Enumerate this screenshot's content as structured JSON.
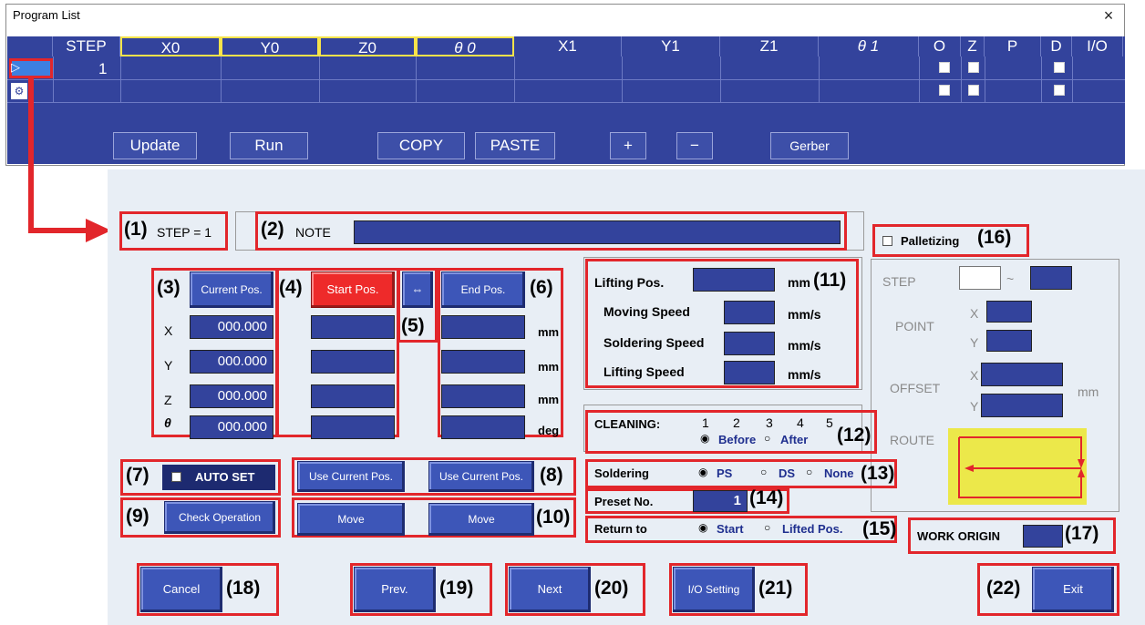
{
  "program_list": {
    "title": "Program List",
    "close": "×",
    "columns": [
      "STEP",
      "X0",
      "Y0",
      "Z0",
      "θ 0",
      "X1",
      "Y1",
      "Z1",
      "θ 1",
      "O",
      "Z",
      "P",
      "D",
      "I/O"
    ],
    "row1_step": "1",
    "row_marker_1": "▷",
    "row_marker_2": "⚙",
    "buttons": {
      "update": "Update",
      "run": "Run",
      "copy": "COPY",
      "paste": "PASTE",
      "plus": "+",
      "minus": "−",
      "gerber": "Gerber"
    }
  },
  "dialog": {
    "step": "STEP = 1",
    "note_label": "NOTE",
    "buttons": {
      "current_pos": "Current Pos.",
      "start_pos": "Start Pos.",
      "swap": "⇔",
      "end_pos": "End Pos.",
      "use_current_1": "Use Current Pos.",
      "use_current_2": "Use Current Pos.",
      "check_operation": "Check Operation",
      "move_1": "Move",
      "move_2": "Move",
      "cancel": "Cancel",
      "prev": "Prev.",
      "next": "Next",
      "io_setting": "I/O Setting",
      "exit": "Exit"
    },
    "axes": [
      "X",
      "Y",
      "Z",
      "θ"
    ],
    "current_values": [
      "000.000",
      "000.000",
      "000.000",
      "000.000"
    ],
    "units": [
      "mm",
      "mm",
      "mm",
      "deg"
    ],
    "auto_set": "AUTO SET",
    "lifting": {
      "lifting_pos": "Lifting Pos.",
      "lifting_pos_unit": "mm",
      "moving_speed": "Moving Speed",
      "moving_unit": "mm/s",
      "soldering_speed": "Soldering Speed",
      "soldering_unit": "mm/s",
      "lifting_speed": "Lifting Speed",
      "lifting_unit": "mm/s"
    },
    "cleaning": {
      "label": "CLEANING:",
      "nums": [
        "1",
        "2",
        "3",
        "4",
        "5"
      ],
      "before": "Before",
      "after": "After",
      "selected": "Before"
    },
    "soldering": {
      "label": "Soldering",
      "opt_ps": "PS",
      "opt_ds": "DS",
      "opt_none": "None",
      "selected": "PS"
    },
    "preset": {
      "label": "Preset No.",
      "value": "1"
    },
    "return_to": {
      "label": "Return to",
      "opt_start": "Start",
      "opt_lifted": "Lifted Pos.",
      "selected": "Start"
    },
    "palletizing": {
      "label": "Palletizing",
      "step": "STEP",
      "tilde": "~",
      "point": "POINT",
      "x": "X",
      "y": "Y",
      "offset": "OFFSET",
      "offset_x": "X",
      "offset_y": "Y",
      "mm": "mm",
      "route": "ROUTE"
    },
    "work_origin": "WORK ORIGIN"
  },
  "callouts": [
    "(1)",
    "(2)",
    "(3)",
    "(4)",
    "(5)",
    "(6)",
    "(7)",
    "(8)",
    "(9)",
    "(10)",
    "(11)",
    "(12)",
    "(13)",
    "(14)",
    "(15)",
    "(16)",
    "(17)",
    "(18)",
    "(19)",
    "(20)",
    "(21)",
    "(22)"
  ],
  "colors": {
    "grid_blue": "#33439c",
    "button_blue": "#3d56b8",
    "start_red": "#ee2a2a",
    "callout_red": "#e2262b",
    "route_yellow": "#ece84a",
    "dialog_bg": "#e8eef5"
  }
}
